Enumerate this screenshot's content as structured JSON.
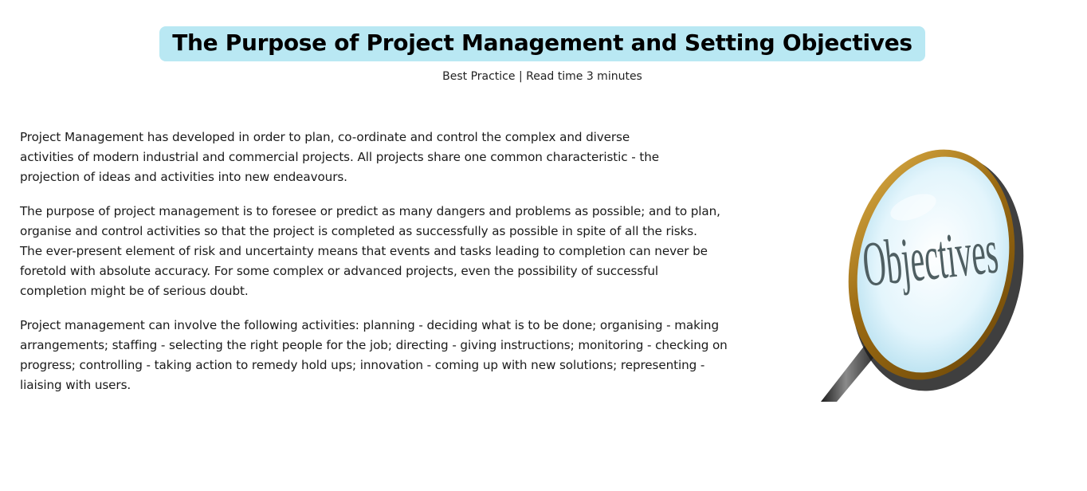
{
  "article": {
    "title": "The Purpose of Project Management and Setting Objectives",
    "meta": "Best Practice | Read time 3 minutes",
    "paragraphs": [
      {
        "lines": [
          "Project Management has developed in order to plan, co-ordinate and control the complex and diverse",
          "activities of modern industrial and commercial projects. All projects share one common characteristic - the",
          "projection of ideas and activities into new endeavours."
        ]
      },
      {
        "lines": [
          "The purpose of project management is to foresee or predict as many dangers and problems as possible; and to plan,",
          "organise and control activities so that the project is completed as successfully as possible in spite of all the risks.",
          "The ever-present element of risk and uncertainty means that events and tasks leading to completion can never be",
          "foretold with absolute accuracy. For some complex or advanced projects, even the possibility of successful",
          "completion might be of serious doubt."
        ]
      },
      {
        "lines": [
          "Project management can involve the following activities: planning - deciding what is to be done; organising - making",
          "arrangements; staffing - selecting the right people for the job; directing - giving instructions; monitoring - checking on",
          "progress; controlling - taking action to remedy hold ups; innovation - coming up with new solutions; representing -",
          "liaising with users."
        ]
      }
    ]
  },
  "illustration": {
    "icon": "magnifying-glass-icon",
    "lens_text": "Objectives",
    "colors": {
      "rim": "#b07a1c",
      "lens": "#dff3fb",
      "text": "#4f5f62",
      "handle": "#2b2b2b"
    }
  },
  "theme": {
    "title_highlight": "#b9e8f3"
  }
}
